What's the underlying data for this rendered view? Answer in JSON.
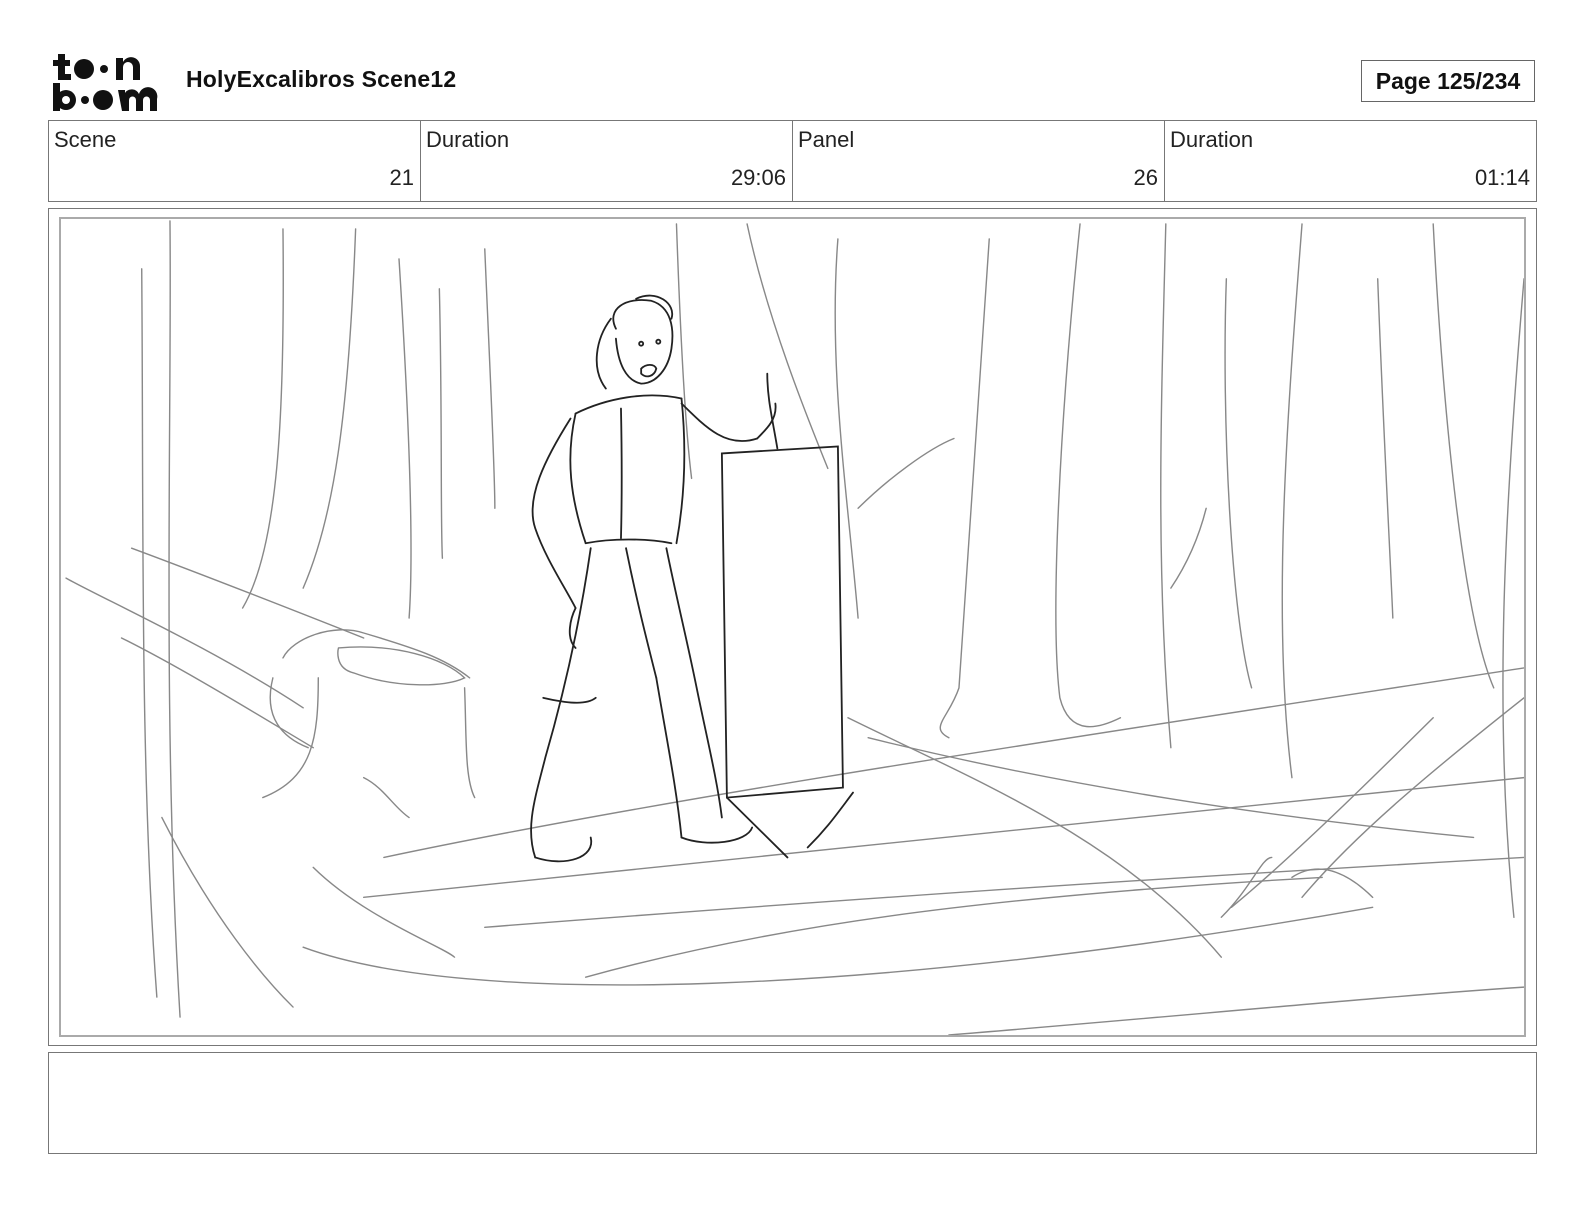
{
  "header": {
    "logo_text": "toon boom",
    "title": "HolyExcalibros Scene12",
    "page_label": "Page 125/234"
  },
  "info": {
    "scene_label": "Scene",
    "scene_value": "21",
    "scene_duration_label": "Duration",
    "scene_duration_value": "29:06",
    "panel_label": "Panel",
    "panel_value": "26",
    "panel_duration_label": "Duration",
    "panel_duration_value": "01:14"
  },
  "notes": {
    "text": ""
  }
}
